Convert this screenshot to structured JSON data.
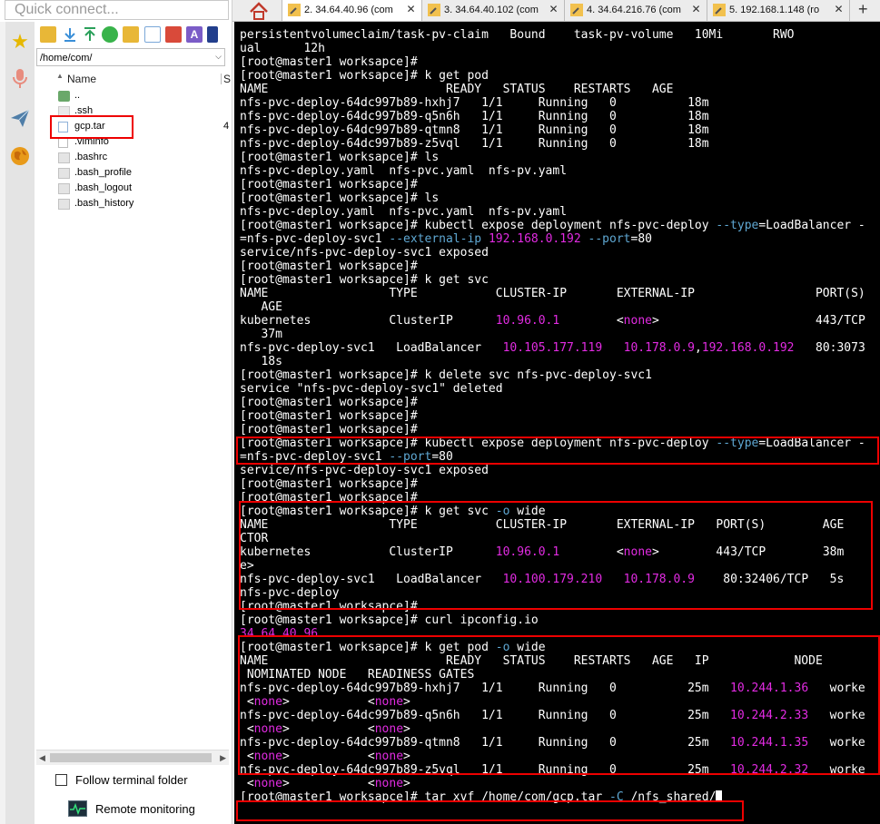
{
  "quick_connect": {
    "placeholder": "Quick connect..."
  },
  "sidebar_icons": [
    "star-icon",
    "microphone-icon",
    "paper-plane-icon",
    "globe-icon"
  ],
  "file_browser": {
    "path": "/home/com/",
    "column_name": "Name",
    "column_size": "S",
    "files": [
      {
        "name": "..",
        "icon": "folder-up-icon",
        "size": ""
      },
      {
        "name": ".ssh",
        "icon": "folder-icon",
        "size": ""
      },
      {
        "name": "gcp.tar",
        "icon": "archive-icon",
        "size": "4"
      },
      {
        "name": ".viminfo",
        "icon": "file-icon",
        "size": ""
      },
      {
        "name": ".bashrc",
        "icon": "file-icon",
        "size": ""
      },
      {
        "name": ".bash_profile",
        "icon": "file-icon",
        "size": ""
      },
      {
        "name": ".bash_logout",
        "icon": "file-icon",
        "size": ""
      },
      {
        "name": ".bash_history",
        "icon": "file-icon",
        "size": ""
      }
    ],
    "follow_label": "Follow terminal folder",
    "remote_label": "Remote monitoring"
  },
  "tabs": [
    {
      "label": "2. 34.64.40.96 (com",
      "active": true
    },
    {
      "label": "3. 34.64.40.102 (com",
      "active": false
    },
    {
      "label": "4. 34.64.216.76 (com",
      "active": false
    },
    {
      "label": "5. 192.168.1.148 (ro",
      "active": false
    }
  ],
  "colors": {
    "highlight": "#e22be2",
    "option": "#5fa8d3",
    "annotation": "#ee0000"
  },
  "terminal": {
    "lines": [
      "persistentvolumeclaim/task-pv-claim   Bound    task-pv-volume   10Mi       RWO",
      "ual      12h",
      "[root@master1 worksapce]#",
      "[root@master1 worksapce]# k get pod",
      "NAME                         READY   STATUS    RESTARTS   AGE",
      "nfs-pvc-deploy-64dc997b89-hxhj7   1/1     Running   0          18m",
      "nfs-pvc-deploy-64dc997b89-q5n6h   1/1     Running   0          18m",
      "nfs-pvc-deploy-64dc997b89-qtmn8   1/1     Running   0          18m",
      "nfs-pvc-deploy-64dc997b89-z5vql   1/1     Running   0          18m",
      "[root@master1 worksapce]# ls",
      "nfs-pvc-deploy.yaml  nfs-pvc.yaml  nfs-pv.yaml",
      "[root@master1 worksapce]#",
      "[root@master1 worksapce]# ls",
      "nfs-pvc-deploy.yaml  nfs-pvc.yaml  nfs-pv.yaml",
      "[root@master1 worksapce]# kubectl expose deployment nfs-pvc-deploy --type=LoadBalancer -",
      "=nfs-pvc-deploy-svc1 --external-ip 192.168.0.192 --port=80",
      "service/nfs-pvc-deploy-svc1 exposed",
      "[root@master1 worksapce]#",
      "[root@master1 worksapce]# k get svc",
      "NAME                 TYPE           CLUSTER-IP       EXTERNAL-IP                 PORT(S)",
      "   AGE",
      "kubernetes           ClusterIP      10.96.0.1        <none>                      443/TCP",
      "   37m",
      "nfs-pvc-deploy-svc1   LoadBalancer   10.105.177.119   10.178.0.9,192.168.0.192   80:3073",
      "   18s",
      "[root@master1 worksapce]# k delete svc nfs-pvc-deploy-svc1",
      "service \"nfs-pvc-deploy-svc1\" deleted",
      "[root@master1 worksapce]#",
      "[root@master1 worksapce]#",
      "[root@master1 worksapce]#",
      "[root@master1 worksapce]# kubectl expose deployment nfs-pvc-deploy --type=LoadBalancer -",
      "=nfs-pvc-deploy-svc1 --port=80",
      "service/nfs-pvc-deploy-svc1 exposed",
      "[root@master1 worksapce]#",
      "[root@master1 worksapce]#",
      "[root@master1 worksapce]# k get svc -o wide",
      "NAME                 TYPE           CLUSTER-IP       EXTERNAL-IP   PORT(S)        AGE",
      "CTOR",
      "kubernetes           ClusterIP      10.96.0.1        <none>        443/TCP        38m",
      "e>",
      "nfs-pvc-deploy-svc1   LoadBalancer   10.100.179.210   10.178.0.9    80:32406/TCP   5s",
      "nfs-pvc-deploy",
      "[root@master1 worksapce]#",
      "[root@master1 worksapce]# curl ipconfig.io",
      "34.64.40.96",
      "[root@master1 worksapce]# k get pod -o wide",
      "NAME                         READY   STATUS    RESTARTS   AGE   IP            NODE",
      " NOMINATED NODE   READINESS GATES",
      "nfs-pvc-deploy-64dc997b89-hxhj7   1/1     Running   0          25m   10.244.1.36   worke",
      " <none>           <none>",
      "nfs-pvc-deploy-64dc997b89-q5n6h   1/1     Running   0          25m   10.244.2.33   worke",
      " <none>           <none>",
      "nfs-pvc-deploy-64dc997b89-qtmn8   1/1     Running   0          25m   10.244.1.35   worke",
      " <none>           <none>",
      "nfs-pvc-deploy-64dc997b89-z5vql   1/1     Running   0          25m   10.244.2.32   worke",
      " <none>           <none>",
      "[root@master1 worksapce]# tar xvf /home/com/gcp.tar -C /nfs_shared/"
    ]
  }
}
